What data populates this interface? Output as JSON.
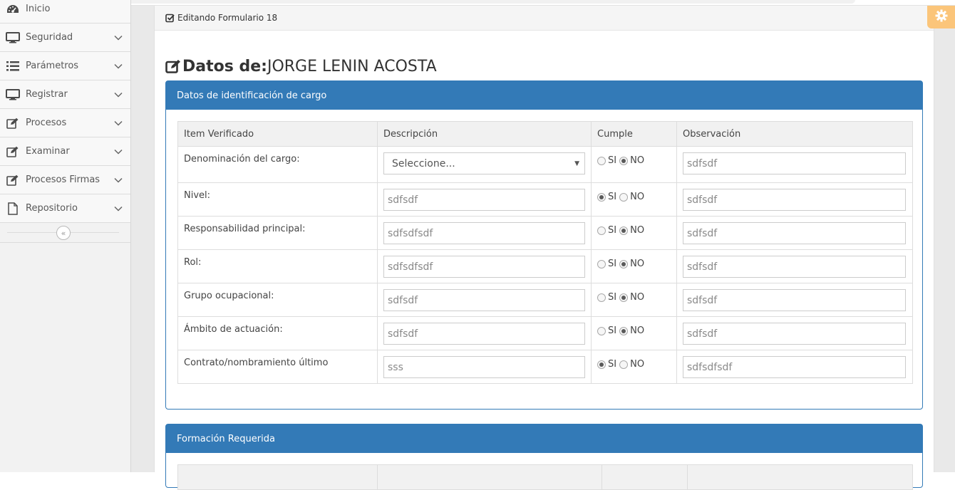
{
  "sidebar": {
    "items": [
      {
        "label": "Inicio",
        "icon": "dashboard-icon"
      },
      {
        "label": "Seguridad",
        "icon": "monitor-icon"
      },
      {
        "label": "Parámetros",
        "icon": "list-icon"
      },
      {
        "label": "Registrar",
        "icon": "monitor-icon"
      },
      {
        "label": "Procesos",
        "icon": "edit-icon"
      },
      {
        "label": "Examinar",
        "icon": "edit-icon"
      },
      {
        "label": "Procesos Firmas",
        "icon": "edit-icon"
      },
      {
        "label": "Repositorio",
        "icon": "file-icon"
      }
    ],
    "collapse_glyph": "«"
  },
  "breadcrumb": {
    "text": "Editando Formulario 18"
  },
  "title": {
    "prefix": "Datos de:",
    "name": "JORGE LENIN ACOSTA"
  },
  "panel1": {
    "heading": "Datos de identificación de cargo",
    "columns": [
      "Item Verificado",
      "Descripción",
      "Cumple",
      "Observación"
    ],
    "rows": [
      {
        "item": "Denominación del cargo:",
        "descripcion": "Seleccione...",
        "type": "select",
        "cumple": "NO",
        "observacion": "sdfsdf"
      },
      {
        "item": "Nivel:",
        "descripcion": "sdfsdf",
        "type": "text",
        "cumple": "SI",
        "observacion": "sdfsdf"
      },
      {
        "item": "Responsabilidad principal:",
        "descripcion": "sdfsdfsdf",
        "type": "text",
        "cumple": "NO",
        "observacion": "sdfsdf"
      },
      {
        "item": "Rol:",
        "descripcion": "sdfsdfsdf",
        "type": "text",
        "cumple": "NO",
        "observacion": "sdfsdf"
      },
      {
        "item": "Grupo ocupacional:",
        "descripcion": "sdfsdf",
        "type": "text",
        "cumple": "NO",
        "observacion": "sdfsdf"
      },
      {
        "item": "Ámbito de actuación:",
        "descripcion": "sdfsdf",
        "type": "text",
        "cumple": "NO",
        "observacion": "sdfsdf"
      },
      {
        "item": "Contrato/nombramiento último",
        "descripcion": "sss",
        "type": "text",
        "cumple": "SI",
        "observacion": "sdfsdfsdf"
      }
    ]
  },
  "radio_labels": {
    "si": "SI",
    "no": "NO"
  },
  "panel2": {
    "heading": "Formación Requerida"
  },
  "colors": {
    "primary": "#337ab7",
    "gear_tab": "#fbc57a"
  }
}
